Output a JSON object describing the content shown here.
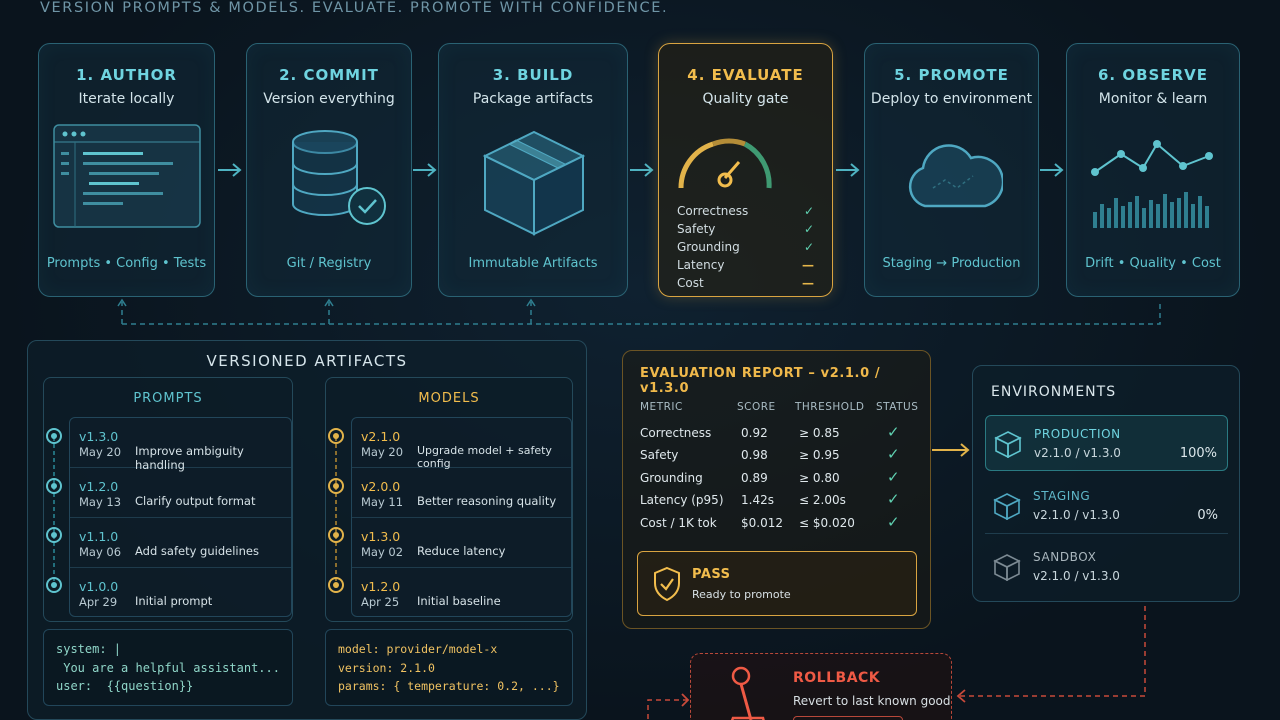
{
  "tagline": "VERSION PROMPTS & MODELS. EVALUATE. PROMOTE WITH CONFIDENCE.",
  "stages": [
    {
      "title": "1. AUTHOR",
      "subtitle": "Iterate locally",
      "footer": "Prompts • Config • Tests",
      "icon": "code-editor-icon"
    },
    {
      "title": "2. COMMIT",
      "subtitle": "Version everything",
      "footer": "Git / Registry",
      "icon": "database-check-icon"
    },
    {
      "title": "3. BUILD",
      "subtitle": "Package artifacts",
      "footer": "Immutable Artifacts",
      "icon": "package-box-icon"
    },
    {
      "title": "4. EVALUATE",
      "subtitle": "Quality gate",
      "icon": "gauge-icon",
      "checks": [
        {
          "label": "Correctness",
          "status": "✓"
        },
        {
          "label": "Safety",
          "status": "✓"
        },
        {
          "label": "Grounding",
          "status": "✓"
        },
        {
          "label": "Latency",
          "status": "—"
        },
        {
          "label": "Cost",
          "status": "—"
        }
      ]
    },
    {
      "title": "5. PROMOTE",
      "subtitle": "Deploy to environment",
      "footer": "Staging → Production",
      "icon": "cloud-icon"
    },
    {
      "title": "6. OBSERVE",
      "subtitle": "Monitor & learn",
      "footer": "Drift • Quality • Cost",
      "icon": "line-chart-icon"
    }
  ],
  "artifacts": {
    "title": "VERSIONED ARTIFACTS",
    "prompts": {
      "title": "PROMPTS",
      "versions": [
        {
          "version": "v1.3.0",
          "date": "May 20",
          "desc": "Improve ambiguity handling"
        },
        {
          "version": "v1.2.0",
          "date": "May 13",
          "desc": "Clarify output format"
        },
        {
          "version": "v1.1.0",
          "date": "May 06",
          "desc": "Add safety guidelines"
        },
        {
          "version": "v1.0.0",
          "date": "Apr 29",
          "desc": "Initial prompt"
        }
      ],
      "code": [
        "system: |",
        " You are a helpful assistant...",
        "user:  {{question}}"
      ]
    },
    "models": {
      "title": "MODELS",
      "versions": [
        {
          "version": "v2.1.0",
          "date": "May 20",
          "desc": "Upgrade model + safety config"
        },
        {
          "version": "v2.0.0",
          "date": "May 11",
          "desc": "Better reasoning quality"
        },
        {
          "version": "v1.3.0",
          "date": "May 02",
          "desc": "Reduce latency"
        },
        {
          "version": "v1.2.0",
          "date": "Apr 25",
          "desc": "Initial baseline"
        }
      ],
      "code": [
        "model: provider/model-x",
        "version: 2.1.0",
        "params: { temperature: 0.2, ...}"
      ]
    }
  },
  "report": {
    "title": "EVALUATION REPORT – v2.1.0 / v1.3.0",
    "headers": [
      "METRIC",
      "SCORE",
      "THRESHOLD",
      "STATUS"
    ],
    "rows": [
      {
        "metric": "Correctness",
        "score": "0.92",
        "threshold": "≥ 0.85",
        "status": "✓"
      },
      {
        "metric": "Safety",
        "score": "0.98",
        "threshold": "≥ 0.95",
        "status": "✓"
      },
      {
        "metric": "Grounding",
        "score": "0.89",
        "threshold": "≥ 0.80",
        "status": "✓"
      },
      {
        "metric": "Latency (p95)",
        "score": "1.42s",
        "threshold": "≤ 2.00s",
        "status": "✓"
      },
      {
        "metric": "Cost / 1K tok",
        "score": "$0.012",
        "threshold": "≤ $0.020",
        "status": "✓"
      }
    ],
    "result": {
      "title": "PASS",
      "subtitle": "Ready to promote"
    }
  },
  "environments": {
    "title": "ENVIRONMENTS",
    "items": [
      {
        "name": "PRODUCTION",
        "version": "v2.1.0 / v1.3.0",
        "traffic": "100%"
      },
      {
        "name": "STAGING",
        "version": "v2.1.0 / v1.3.0",
        "traffic": "0%"
      },
      {
        "name": "SANDBOX",
        "version": "v2.1.0 / v1.3.0",
        "traffic": ""
      }
    ]
  },
  "rollback": {
    "title": "ROLLBACK",
    "subtitle": "Revert to last known good"
  },
  "colors": {
    "teal": "#5fc4cf",
    "amber": "#f2bd4d",
    "red": "#ef5a45",
    "green": "#5fd0b0"
  }
}
